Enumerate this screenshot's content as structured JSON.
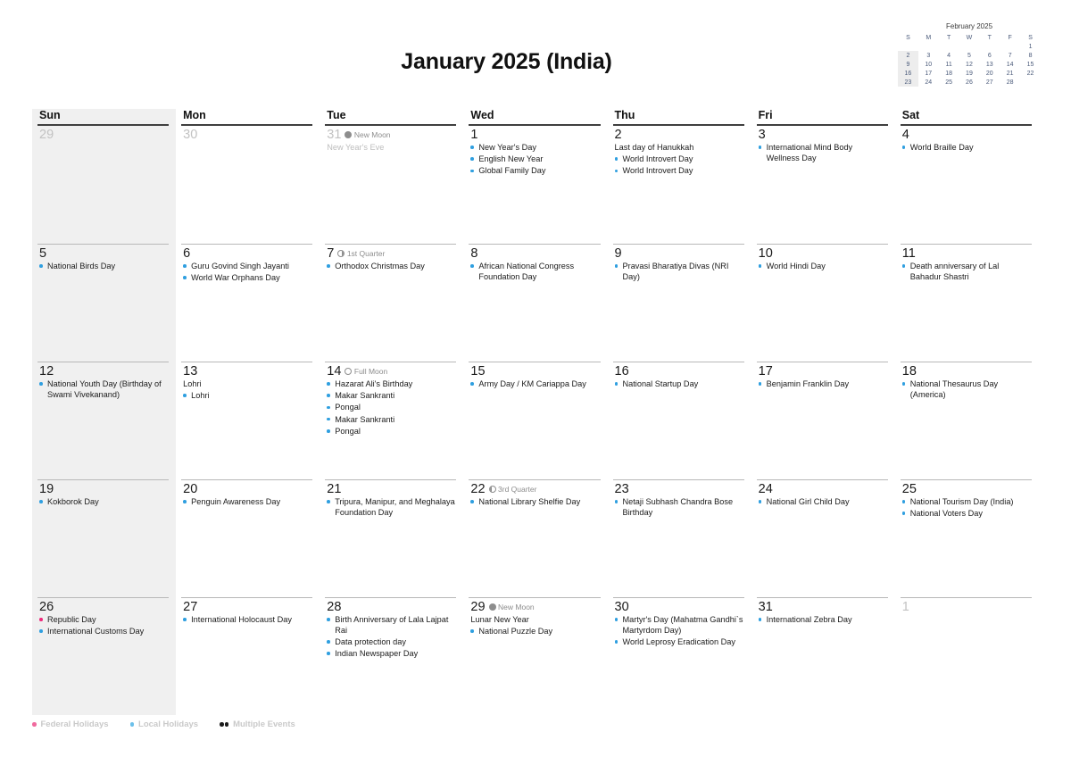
{
  "header": {
    "title": "January 2025 (India)"
  },
  "mini_calendar": {
    "title": "February 2025",
    "dow": [
      "S",
      "M",
      "T",
      "W",
      "T",
      "F",
      "S"
    ],
    "weeks": [
      [
        "",
        "",
        "",
        "",
        "",
        "",
        "1"
      ],
      [
        "2",
        "3",
        "4",
        "5",
        "6",
        "7",
        "8"
      ],
      [
        "9",
        "10",
        "11",
        "12",
        "13",
        "14",
        "15"
      ],
      [
        "16",
        "17",
        "18",
        "19",
        "20",
        "21",
        "22"
      ],
      [
        "23",
        "24",
        "25",
        "26",
        "27",
        "28",
        ""
      ]
    ]
  },
  "calendar": {
    "dow_headers": [
      "Sun",
      "Mon",
      "Tue",
      "Wed",
      "Thu",
      "Fri",
      "Sat"
    ],
    "weeks": [
      [
        {
          "day": "29",
          "other": true,
          "events": []
        },
        {
          "day": "30",
          "other": true,
          "events": []
        },
        {
          "day": "31",
          "other": true,
          "moon": {
            "phase": "new",
            "label": "New Moon"
          },
          "events": [
            {
              "text": "New Year's Eve",
              "type": "plain"
            }
          ]
        },
        {
          "day": "1",
          "events": [
            {
              "text": "New Year's Day",
              "type": "local"
            },
            {
              "text": "English New Year",
              "type": "local"
            },
            {
              "text": "Global Family Day",
              "type": "local"
            }
          ]
        },
        {
          "day": "2",
          "events": [
            {
              "text": "Last day of Hanukkah",
              "type": "plain"
            },
            {
              "text": "World Introvert Day",
              "type": "local"
            },
            {
              "text": "World Introvert Day",
              "type": "local"
            }
          ]
        },
        {
          "day": "3",
          "events": [
            {
              "text": "International Mind Body Wellness Day",
              "type": "local"
            }
          ]
        },
        {
          "day": "4",
          "events": [
            {
              "text": "World Braille Day",
              "type": "local"
            }
          ]
        }
      ],
      [
        {
          "day": "5",
          "events": [
            {
              "text": "National Birds Day",
              "type": "local"
            }
          ]
        },
        {
          "day": "6",
          "events": [
            {
              "text": "Guru Govind Singh Jayanti",
              "type": "local"
            },
            {
              "text": "World War Orphans Day",
              "type": "local"
            }
          ]
        },
        {
          "day": "7",
          "moon": {
            "phase": "first",
            "label": "1st Quarter"
          },
          "events": [
            {
              "text": "Orthodox Christmas Day",
              "type": "local"
            }
          ]
        },
        {
          "day": "8",
          "events": [
            {
              "text": "African National Congress Foundation Day",
              "type": "local"
            }
          ]
        },
        {
          "day": "9",
          "events": [
            {
              "text": "Pravasi Bharatiya Divas (NRI Day)",
              "type": "local"
            }
          ]
        },
        {
          "day": "10",
          "events": [
            {
              "text": "World Hindi Day",
              "type": "local"
            }
          ]
        },
        {
          "day": "11",
          "events": [
            {
              "text": "Death anniversary of Lal Bahadur Shastri",
              "type": "local"
            }
          ]
        }
      ],
      [
        {
          "day": "12",
          "events": [
            {
              "text": "National Youth Day (Birthday of Swami Vivekanand)",
              "type": "local"
            }
          ]
        },
        {
          "day": "13",
          "events": [
            {
              "text": "Lohri",
              "type": "plain"
            },
            {
              "text": "Lohri",
              "type": "local"
            }
          ]
        },
        {
          "day": "14",
          "moon": {
            "phase": "full",
            "label": "Full Moon"
          },
          "events": [
            {
              "text": "Hazarat Ali's Birthday",
              "type": "local"
            },
            {
              "text": "Makar Sankranti",
              "type": "local"
            },
            {
              "text": "Pongal",
              "type": "local"
            },
            {
              "text": "Makar Sankranti",
              "type": "local"
            },
            {
              "text": "Pongal",
              "type": "local"
            }
          ]
        },
        {
          "day": "15",
          "events": [
            {
              "text": "Army Day / KM Cariappa Day",
              "type": "local"
            }
          ]
        },
        {
          "day": "16",
          "events": [
            {
              "text": "National Startup Day",
              "type": "local"
            }
          ]
        },
        {
          "day": "17",
          "events": [
            {
              "text": "Benjamin Franklin Day",
              "type": "local"
            }
          ]
        },
        {
          "day": "18",
          "events": [
            {
              "text": "National Thesaurus Day (America)",
              "type": "local"
            }
          ]
        }
      ],
      [
        {
          "day": "19",
          "events": [
            {
              "text": "Kokborok Day",
              "type": "local"
            }
          ]
        },
        {
          "day": "20",
          "events": [
            {
              "text": "Penguin Awareness Day",
              "type": "local"
            }
          ]
        },
        {
          "day": "21",
          "events": [
            {
              "text": "Tripura, Manipur, and Meghalaya Foundation Day",
              "type": "local"
            }
          ]
        },
        {
          "day": "22",
          "moon": {
            "phase": "third",
            "label": "3rd Quarter"
          },
          "events": [
            {
              "text": "National Library Shelfie Day",
              "type": "local"
            }
          ]
        },
        {
          "day": "23",
          "events": [
            {
              "text": "Netaji Subhash Chandra Bose Birthday",
              "type": "local"
            }
          ]
        },
        {
          "day": "24",
          "events": [
            {
              "text": "National Girl Child Day",
              "type": "local"
            }
          ]
        },
        {
          "day": "25",
          "events": [
            {
              "text": "National Tourism Day (India)",
              "type": "local"
            },
            {
              "text": "National Voters Day",
              "type": "local"
            }
          ]
        }
      ],
      [
        {
          "day": "26",
          "events": [
            {
              "text": "Republic Day",
              "type": "federal"
            },
            {
              "text": "International Customs Day",
              "type": "local"
            }
          ]
        },
        {
          "day": "27",
          "events": [
            {
              "text": "International Holocaust Day",
              "type": "local"
            }
          ]
        },
        {
          "day": "28",
          "events": [
            {
              "text": "Birth Anniversary of Lala Lajpat Rai",
              "type": "local"
            },
            {
              "text": "Data protection day",
              "type": "local"
            },
            {
              "text": "Indian Newspaper Day",
              "type": "local"
            }
          ]
        },
        {
          "day": "29",
          "moon": {
            "phase": "new",
            "label": "New Moon"
          },
          "events": [
            {
              "text": "Lunar New Year",
              "type": "plain"
            },
            {
              "text": "National Puzzle Day",
              "type": "local"
            }
          ]
        },
        {
          "day": "30",
          "events": [
            {
              "text": "Martyr's Day (Mahatma Gandhi`s Martyrdom Day)",
              "type": "local"
            },
            {
              "text": "World Leprosy Eradication Day",
              "type": "local"
            }
          ]
        },
        {
          "day": "31",
          "events": [
            {
              "text": "International Zebra Day",
              "type": "local"
            }
          ]
        },
        {
          "day": "1",
          "other": true,
          "events": []
        }
      ]
    ]
  },
  "legend": {
    "federal": "Federal Holidays",
    "local": "Local Holidays",
    "multiple": "Multiple Events"
  },
  "colors": {
    "federal": "#ee2a7b",
    "local": "#2f9fe0",
    "sunday_background": "#f0f0f0",
    "moon": "#8d8d8d"
  }
}
